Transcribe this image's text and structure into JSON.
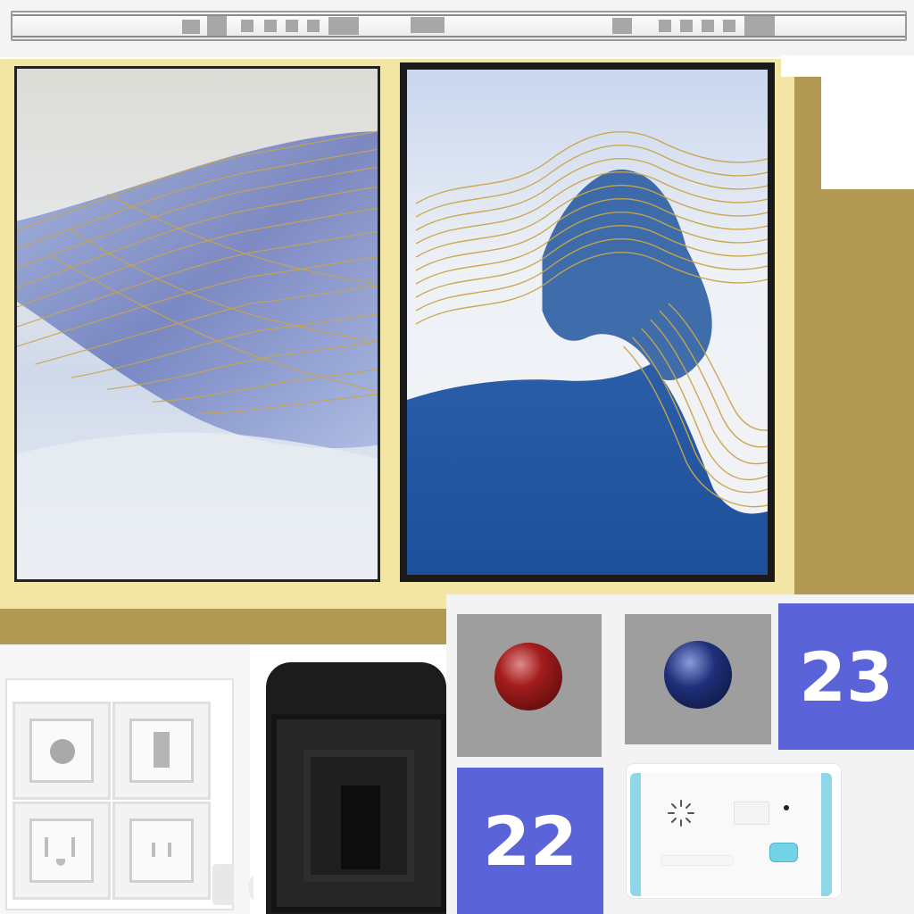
{
  "tiles": {
    "tile_a": "23",
    "tile_b": "22",
    "color": "#5b63d9"
  },
  "balls": {
    "left_color": "#a31d1d",
    "right_color": "#1f2f7a"
  },
  "colors": {
    "frame_yellow": "#f3e6a4",
    "khaki": "#b29a55",
    "gold": "#c9a64a",
    "deep_blue": "#1e4f9a"
  },
  "icons": [
    "socket-round-icon",
    "socket-slot-icon",
    "socket-grounded-icon",
    "socket-two-pin-icon",
    "speaker-icon",
    "status-led-icon",
    "test-button-icon"
  ]
}
